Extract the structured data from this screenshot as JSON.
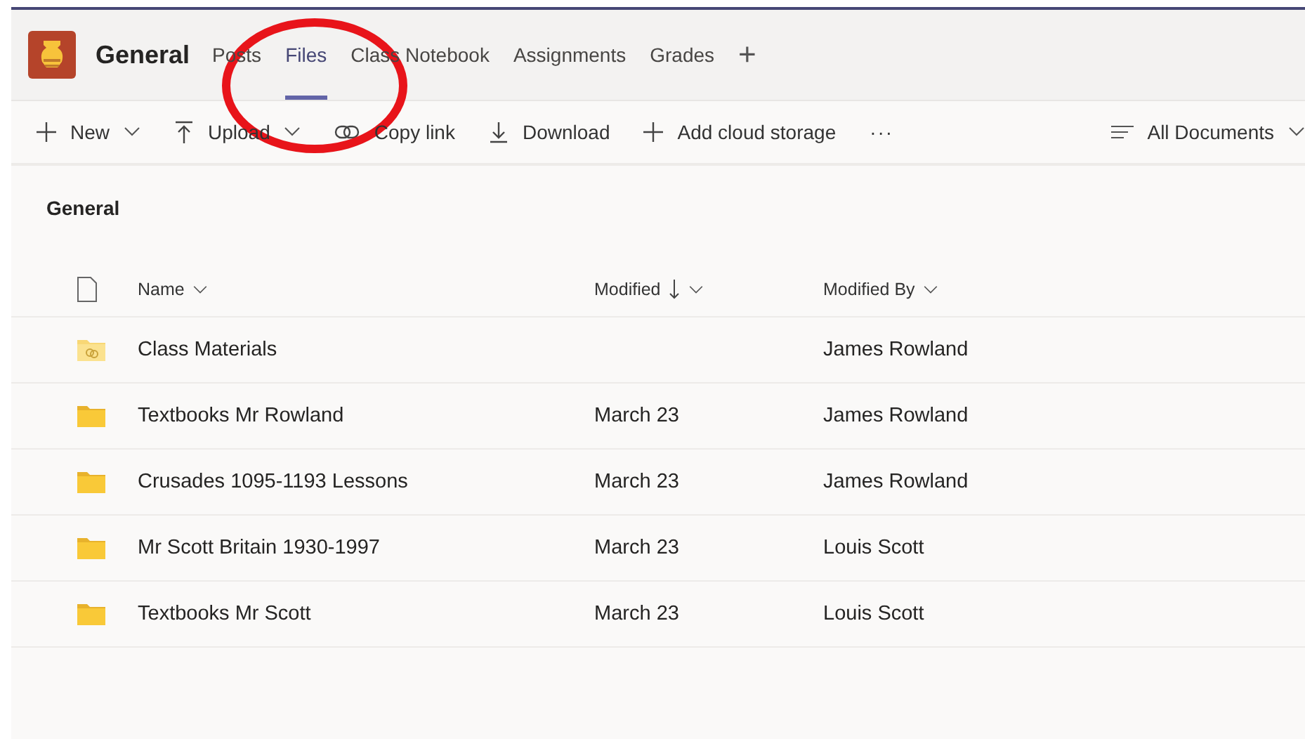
{
  "header": {
    "channel_name": "General",
    "tabs": [
      {
        "label": "Posts",
        "selected": false
      },
      {
        "label": "Files",
        "selected": true
      },
      {
        "label": "Class Notebook",
        "selected": false
      },
      {
        "label": "Assignments",
        "selected": false
      },
      {
        "label": "Grades",
        "selected": false
      }
    ],
    "add_tab": "+"
  },
  "toolbar": {
    "actions": [
      {
        "kind": "plus",
        "label": "New",
        "dropdown": true
      },
      {
        "kind": "upload",
        "label": "Upload",
        "dropdown": true
      },
      {
        "kind": "link",
        "label": "Copy link",
        "dropdown": false
      },
      {
        "kind": "download",
        "label": "Download",
        "dropdown": false
      },
      {
        "kind": "plus",
        "label": "Add cloud storage",
        "dropdown": false
      }
    ],
    "more": "···",
    "view": "All Documents"
  },
  "breadcrumb": "General",
  "table": {
    "columns": [
      {
        "label": "Name",
        "sorted": false
      },
      {
        "label": "Modified",
        "sorted": true
      },
      {
        "label": "Modified By",
        "sorted": false
      }
    ],
    "rows": [
      {
        "kind": "shared",
        "name": "Class Materials",
        "modified": "",
        "modified_by": "James Rowland"
      },
      {
        "kind": "folder",
        "name": "Textbooks Mr Rowland",
        "modified": "March 23",
        "modified_by": "James Rowland"
      },
      {
        "kind": "folder",
        "name": "Crusades 1095-1193 Lessons",
        "modified": "March 23",
        "modified_by": "James Rowland"
      },
      {
        "kind": "folder",
        "name": "Mr Scott Britain 1930-1997",
        "modified": "March 23",
        "modified_by": "Louis Scott"
      },
      {
        "kind": "folder",
        "name": "Textbooks Mr Scott",
        "modified": "March 23",
        "modified_by": "Louis Scott"
      }
    ]
  },
  "annotation": {
    "kind": "circle"
  }
}
